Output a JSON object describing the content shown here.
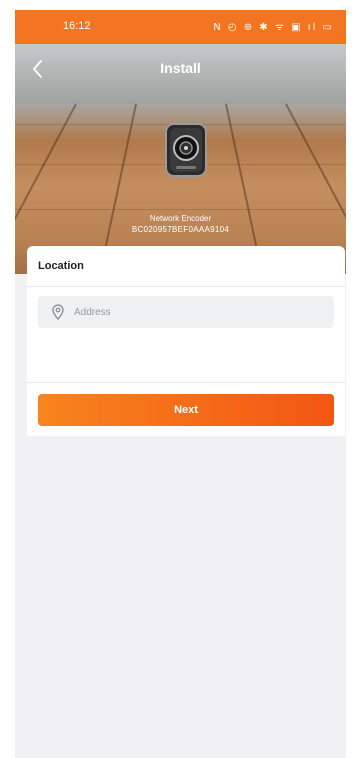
{
  "status_bar": {
    "time": "16:12",
    "icons": "N ◴ ⊛ ✱ ᯤ ▣ ıl ▭"
  },
  "header": {
    "title": "Install"
  },
  "device": {
    "name": "Network Encoder",
    "id": "BC020957BEF0AAA9104"
  },
  "location": {
    "label": "Location",
    "address_placeholder": "Address",
    "address_value": ""
  },
  "actions": {
    "next_label": "Next"
  },
  "colors": {
    "accent": "#f37522",
    "button_start": "#f7841d",
    "button_end": "#f25614",
    "background": "#f1f1f3"
  },
  "icons": {
    "back": "chevron-left-icon",
    "pin": "location-pin-icon"
  }
}
